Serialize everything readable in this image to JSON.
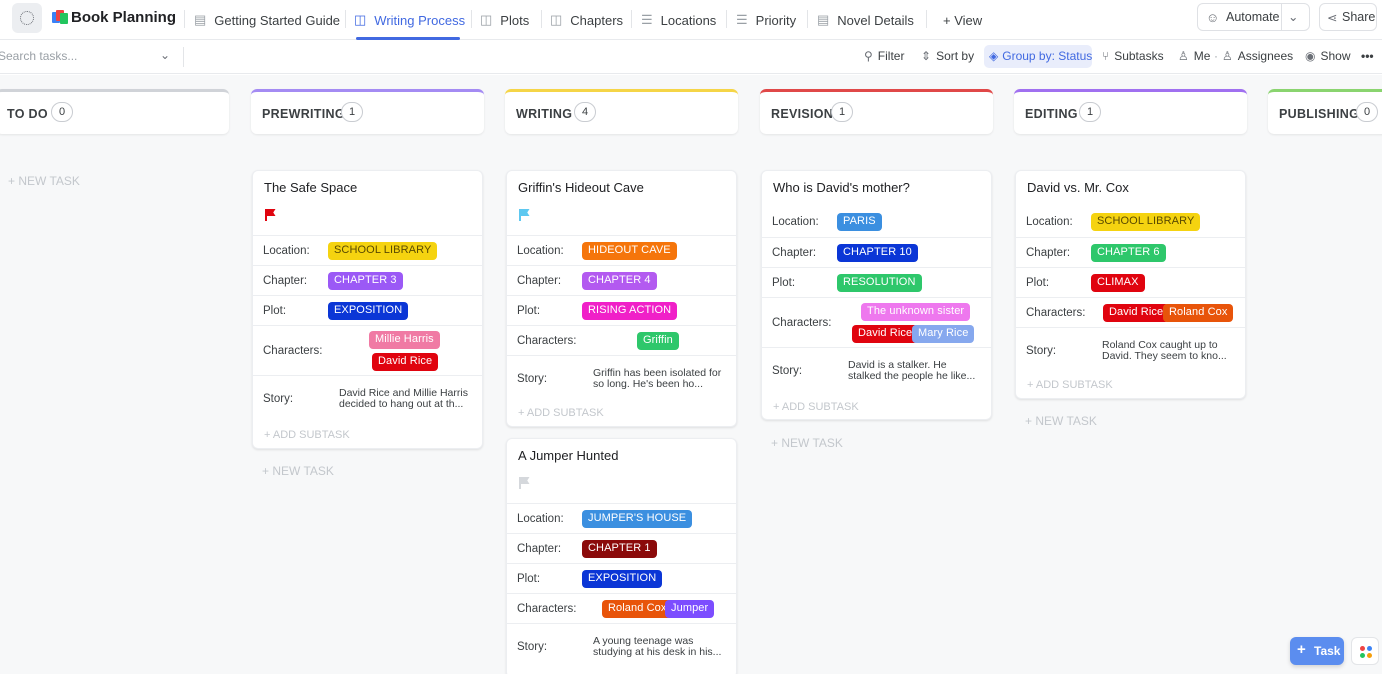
{
  "app": {
    "title": "Book Planning"
  },
  "tabs": [
    {
      "label": "Getting Started Guide",
      "icon": "doc-icon"
    },
    {
      "label": "Writing Process",
      "icon": "board-icon",
      "active": true
    },
    {
      "label": "Plots",
      "icon": "board-icon"
    },
    {
      "label": "Chapters",
      "icon": "board-icon"
    },
    {
      "label": "Locations",
      "icon": "list-icon"
    },
    {
      "label": "Priority",
      "icon": "list-icon"
    },
    {
      "label": "Novel Details",
      "icon": "doc-icon"
    }
  ],
  "add_view": "+ View",
  "automate": "Automate",
  "share": "Share",
  "search": {
    "placeholder": "Search tasks..."
  },
  "filters": {
    "filter": "Filter",
    "sort": "Sort by",
    "group": "Group by: Status",
    "subtasks": "Subtasks",
    "me": "Me",
    "assignees": "Assignees",
    "show": "Show",
    "more": "•••"
  },
  "columns": [
    {
      "name": "TO DO",
      "count": "0",
      "color": "#d0d3d8"
    },
    {
      "name": "PREWRITING",
      "count": "1",
      "color": "#a48bf3"
    },
    {
      "name": "WRITING",
      "count": "4",
      "color": "#f5d547"
    },
    {
      "name": "REVISION",
      "count": "1",
      "color": "#e04848"
    },
    {
      "name": "EDITING",
      "count": "1",
      "color": "#a070f0"
    },
    {
      "name": "PUBLISHING",
      "count": "0",
      "color": "#8ad46f"
    }
  ],
  "labels": {
    "location": "Location:",
    "chapter": "Chapter:",
    "plot": "Plot:",
    "characters": "Characters:",
    "story": "Story:",
    "new_task": "+ NEW TASK",
    "add_subtask": "+ ADD SUBTASK"
  },
  "cards": {
    "safe_space": {
      "title": "The Safe Space",
      "priority_flag": "red",
      "location": "SCHOOL LIBRARY",
      "chapter": "CHAPTER 3",
      "plot": "EXPOSITION",
      "characters": [
        "Millie Harris",
        "David Rice"
      ],
      "story": "David Rice and Millie Harris decided to hang out at th..."
    },
    "griffin": {
      "title": "Griffin's Hideout Cave",
      "priority_flag": "light-blue",
      "location": "HIDEOUT CAVE",
      "chapter": "CHAPTER 4",
      "plot": "RISING ACTION",
      "characters": [
        "Griffin"
      ],
      "story": "Griffin has been isolated for so long. He's been ho..."
    },
    "jumper": {
      "title": "A Jumper Hunted",
      "priority_flag": "grey",
      "location": "JUMPER'S HOUSE",
      "chapter": "CHAPTER 1",
      "plot": "EXPOSITION",
      "characters": [
        "Roland Cox",
        "Jumper"
      ],
      "story": "A young teenage was studying at his desk in his..."
    },
    "mother": {
      "title": "Who is David's mother?",
      "location": "PARIS",
      "chapter": "CHAPTER 10",
      "plot": "RESOLUTION",
      "characters": [
        "The unknown sister",
        "David Rice",
        "Mary Rice"
      ],
      "story": "David is a stalker. He stalked the people he like..."
    },
    "cox": {
      "title": "David vs. Mr. Cox",
      "location": "SCHOOL LIBRARY",
      "chapter": "CHAPTER 6",
      "plot": "CLIMAX",
      "characters": [
        "David Rice",
        "Roland Cox"
      ],
      "story": "Roland Cox caught up to David. They seem to kno..."
    }
  },
  "fab": {
    "label": "Task"
  },
  "colors": {
    "accent": "#4169e1",
    "school_library": "#f5d310",
    "chapter_3": "#9b59f6",
    "exposition": "#0b36d6",
    "millie_harris": "#f07aa4",
    "david_rice": "#e0040f",
    "hideout_cave": "#f5750b",
    "chapter_4": "#b35af0",
    "rising_action": "#f020c8",
    "griffin": "#2ec76b",
    "jumpers_house": "#3b8fe0",
    "chapter_1": "#8b0a0a",
    "roland_cox": "#e8540a",
    "jumper": "#7c4dff",
    "paris": "#3b8fe0",
    "chapter_10": "#0b36d6",
    "resolution": "#2ec76b",
    "unknown_sister": "#ee78ee",
    "mary_rice": "#86a8ee",
    "chapter_6": "#2ec76b",
    "climax": "#e0040f"
  }
}
